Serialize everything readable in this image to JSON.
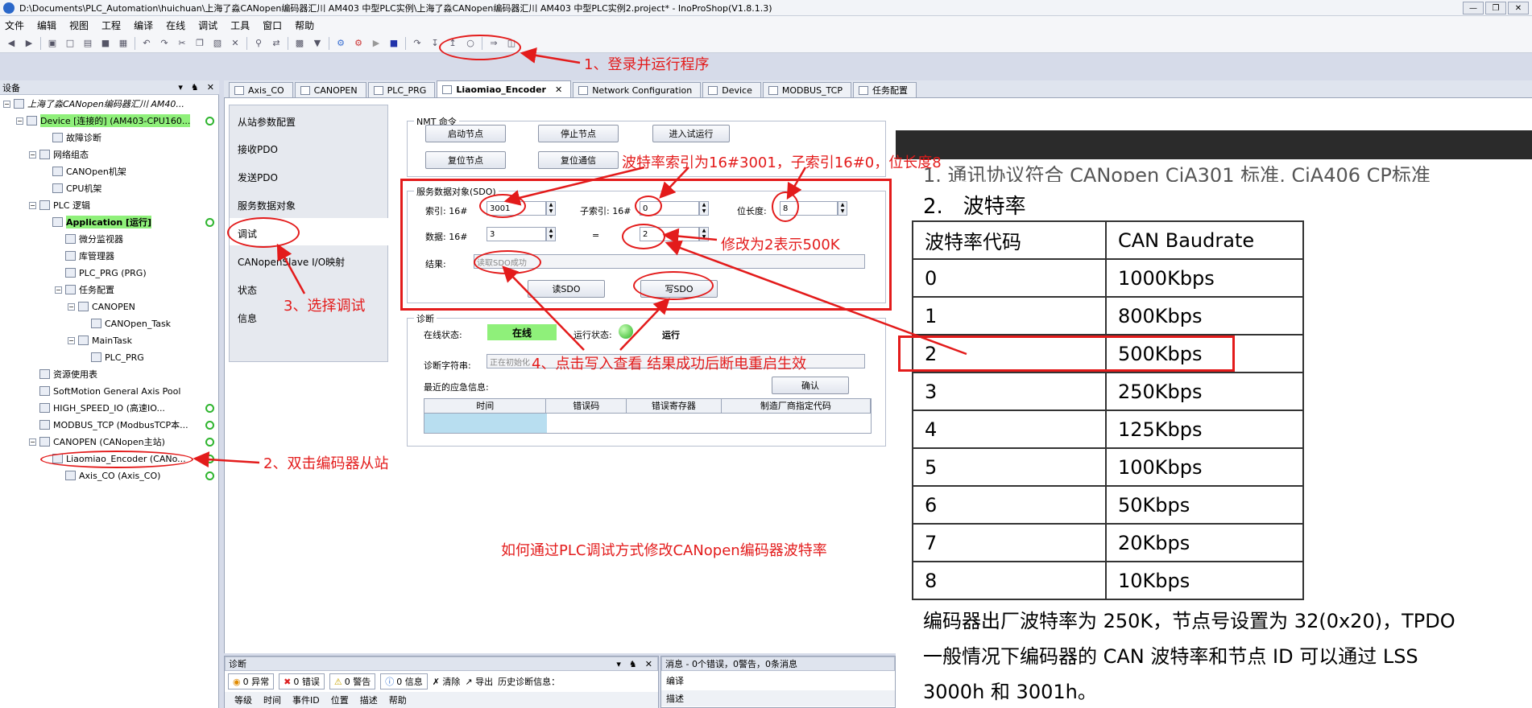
{
  "window": {
    "title": "D:\\Documents\\PLC_Automation\\huichuan\\上海了淼CANopen编码器汇川 AM403 中型PLC实例\\上海了淼CANopen编码器汇川 AM403 中型PLC实例2.project* - InoProShop(V1.8.1.3)"
  },
  "menu": [
    "文件",
    "编辑",
    "视图",
    "工程",
    "编译",
    "在线",
    "调试",
    "工具",
    "窗口",
    "帮助"
  ],
  "devices_panel": {
    "title": "设备",
    "tree": [
      {
        "label": "上海了淼CANopen编码器汇川 AM40...",
        "indent": 0
      },
      {
        "label": "Device [连接的] (AM403-CPU160...",
        "indent": 1,
        "highlight": true,
        "status": true
      },
      {
        "label": "故障诊断",
        "indent": 3
      },
      {
        "label": "网络组态",
        "indent": 2
      },
      {
        "label": "CANOpen机架",
        "indent": 3
      },
      {
        "label": "CPU机架",
        "indent": 3
      },
      {
        "label": "PLC 逻辑",
        "indent": 2
      },
      {
        "label": "Application [运行]",
        "indent": 3,
        "highlight": true,
        "bold": true,
        "status": true
      },
      {
        "label": "微分监视器",
        "indent": 4
      },
      {
        "label": "库管理器",
        "indent": 4
      },
      {
        "label": "PLC_PRG (PRG)",
        "indent": 4
      },
      {
        "label": "任务配置",
        "indent": 4
      },
      {
        "label": "CANOPEN",
        "indent": 5
      },
      {
        "label": "CANOpen_Task",
        "indent": 6
      },
      {
        "label": "MainTask",
        "indent": 5
      },
      {
        "label": "PLC_PRG",
        "indent": 6
      },
      {
        "label": "资源使用表",
        "indent": 2
      },
      {
        "label": "SoftMotion General Axis Pool",
        "indent": 2
      },
      {
        "label": "HIGH_SPEED_IO (高速IO...",
        "indent": 2,
        "status": true
      },
      {
        "label": "MODBUS_TCP (ModbusTCP本...",
        "indent": 2,
        "status": true
      },
      {
        "label": "CANOPEN (CANopen主站)",
        "indent": 2,
        "status": true
      },
      {
        "label": "Liaomiao_Encoder (CANo...",
        "indent": 3,
        "status": true
      },
      {
        "label": "Axis_CO (Axis_CO)",
        "indent": 4,
        "status": true
      }
    ]
  },
  "tabs": [
    {
      "label": "Axis_CO"
    },
    {
      "label": "CANOPEN"
    },
    {
      "label": "PLC_PRG"
    },
    {
      "label": "Liaomiao_Encoder",
      "active": true
    },
    {
      "label": "Network Configuration"
    },
    {
      "label": "Device"
    },
    {
      "label": "MODBUS_TCP"
    },
    {
      "label": "任务配置"
    }
  ],
  "config_nav": [
    "从站参数配置",
    "接收PDO",
    "发送PDO",
    "服务数据对象",
    "调试",
    "CANopenSlave I/O映射",
    "状态",
    "信息"
  ],
  "nmt": {
    "title": "NMT 命令",
    "start_node": "启动节点",
    "stop_node": "停止节点",
    "enter_preop": "进入试运行",
    "reset_node": "复位节点",
    "reset_comm": "复位通信"
  },
  "sdo": {
    "title": "服务数据对象(SDO)",
    "index_label": "索引: 16#",
    "index_value": "3001",
    "subindex_label": "子索引: 16#",
    "subindex_value": "0",
    "bitlen_label": "位长度:",
    "bitlen_value": "8",
    "data_label": "数据: 16#",
    "data_value": "3",
    "equals": "=",
    "data2_value": "2",
    "result_label": "结果:",
    "result_value": "读取SDO成功",
    "read_btn": "读SDO",
    "write_btn": "写SDO"
  },
  "diag": {
    "title": "诊断",
    "online_label": "在线状态:",
    "online_value": "在线",
    "run_label": "运行状态:",
    "run_value": "运行",
    "diagstr_label": "诊断字符串:",
    "diagstr_value": "正在初始化",
    "emergency_label": "最近的应急信息:",
    "confirm_btn": "确认",
    "columns": [
      "时间",
      "错误码",
      "错误寄存器",
      "制造厂商指定代码"
    ]
  },
  "annotations": {
    "a1": "1、登录并运行程序",
    "a2": "2、双击编码器从站",
    "a3": "3、选择调试",
    "a4": "4、点击写入查看 结果成功后断电重启生效",
    "note_index": "波特率索引为16#3001，子索引16#0，位长度8",
    "note_data": "修改为2表示500K",
    "caption": "如何通过PLC调试方式修改CANopen编码器波特率"
  },
  "doc": {
    "partial_heading": "1. 通讯协议符合 CANopen CiA301 标准, CiA406 CP标准",
    "heading": "2.   波特率",
    "header": [
      "波特率代码",
      "CAN  Baudrate"
    ],
    "rows": [
      [
        "0",
        "1000Kbps"
      ],
      [
        "1",
        "800Kbps"
      ],
      [
        "2",
        "500Kbps"
      ],
      [
        "3",
        "250Kbps"
      ],
      [
        "4",
        "125Kbps"
      ],
      [
        "5",
        "100Kbps"
      ],
      [
        "6",
        "50Kbps"
      ],
      [
        "7",
        "20Kbps"
      ],
      [
        "8",
        "10Kbps"
      ]
    ],
    "line1": "编码器出厂波特率为 250K，节点号设置为 32(0x20)，TPDO",
    "line2": "一般情况下编码器的 CAN 波特率和节点 ID 可以通过 LSS",
    "line3": "3000h 和 3001h。"
  },
  "bottom": {
    "diag_title": "诊断",
    "exceptions": "0 异常",
    "errors": "0 错误",
    "warnings": "0 警告",
    "infos": "0 信息",
    "clear": "清除",
    "export": "导出",
    "history": "历史诊断信息：",
    "cols": [
      "等级",
      "时间",
      "事件ID",
      "位置",
      "描述",
      "帮助"
    ],
    "msg_title": "消息 - 0个错误，0警告，0条消息",
    "msg_col": "编译",
    "msg_col2": "描述"
  }
}
